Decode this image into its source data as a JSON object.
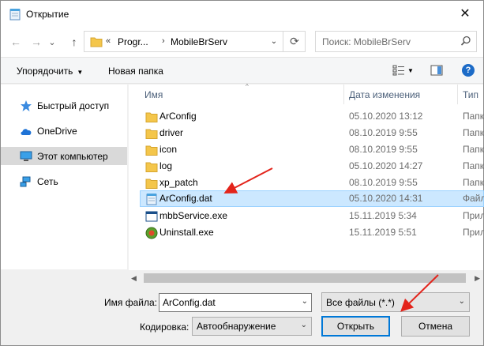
{
  "window": {
    "title": "Открытие",
    "close": "✕"
  },
  "nav": {
    "back": "←",
    "forward": "→",
    "recent": "⌄",
    "up": "↑",
    "address": {
      "prefix": "«",
      "segment1": "Progr...",
      "separator": "›",
      "segment2": "MobileBrServ",
      "dropdown": "⌄",
      "refresh": "⟳"
    },
    "search_placeholder": "Поиск: MobileBrServ"
  },
  "toolbar": {
    "organize": "Упорядочить",
    "organize_caret": "▼",
    "new_folder": "Новая папка",
    "view_caret": "▼",
    "help": "?"
  },
  "sidebar": {
    "items": [
      {
        "label": "Быстрый доступ",
        "icon": "star-icon"
      },
      {
        "label": "OneDrive",
        "icon": "cloud-icon"
      },
      {
        "label": "Этот компьютер",
        "icon": "computer-icon",
        "selected": true
      },
      {
        "label": "Сеть",
        "icon": "network-icon"
      }
    ]
  },
  "columns": {
    "name": "Имя",
    "date": "Дата изменения",
    "type": "Тип",
    "sort_caret": "^"
  },
  "files": [
    {
      "name": "ArConfig",
      "date": "05.10.2020 13:12",
      "type": "Папка",
      "icon": "folder"
    },
    {
      "name": "driver",
      "date": "08.10.2019 9:55",
      "type": "Папка",
      "icon": "folder"
    },
    {
      "name": "icon",
      "date": "08.10.2019 9:55",
      "type": "Папка",
      "icon": "folder"
    },
    {
      "name": "log",
      "date": "05.10.2020 14:27",
      "type": "Папка",
      "icon": "folder"
    },
    {
      "name": "xp_patch",
      "date": "08.10.2019 9:55",
      "type": "Папка",
      "icon": "folder"
    },
    {
      "name": "ArConfig.dat",
      "date": "05.10.2020 14:31",
      "type": "Файл",
      "icon": "file",
      "selected": true
    },
    {
      "name": "mbbService.exe",
      "date": "15.11.2019 5:34",
      "type": "Прил",
      "icon": "exe"
    },
    {
      "name": "Uninstall.exe",
      "date": "15.11.2019 5:51",
      "type": "Прил",
      "icon": "uninstall"
    }
  ],
  "bottom": {
    "filename_label": "Имя файла:",
    "filename_value": "ArConfig.dat",
    "filetype_value": "Все файлы  (*.*)",
    "encoding_label": "Кодировка:",
    "encoding_value": "Автообнаружение",
    "open_label": "Открыть",
    "cancel_label": "Отмена",
    "dropdown": "⌄"
  },
  "scroll": {
    "left": "◀",
    "right": "▶"
  },
  "colors": {
    "accent": "#0078d7",
    "selection": "#cce8ff",
    "folder": "#f4c64b",
    "arrow": "#e3241b"
  }
}
